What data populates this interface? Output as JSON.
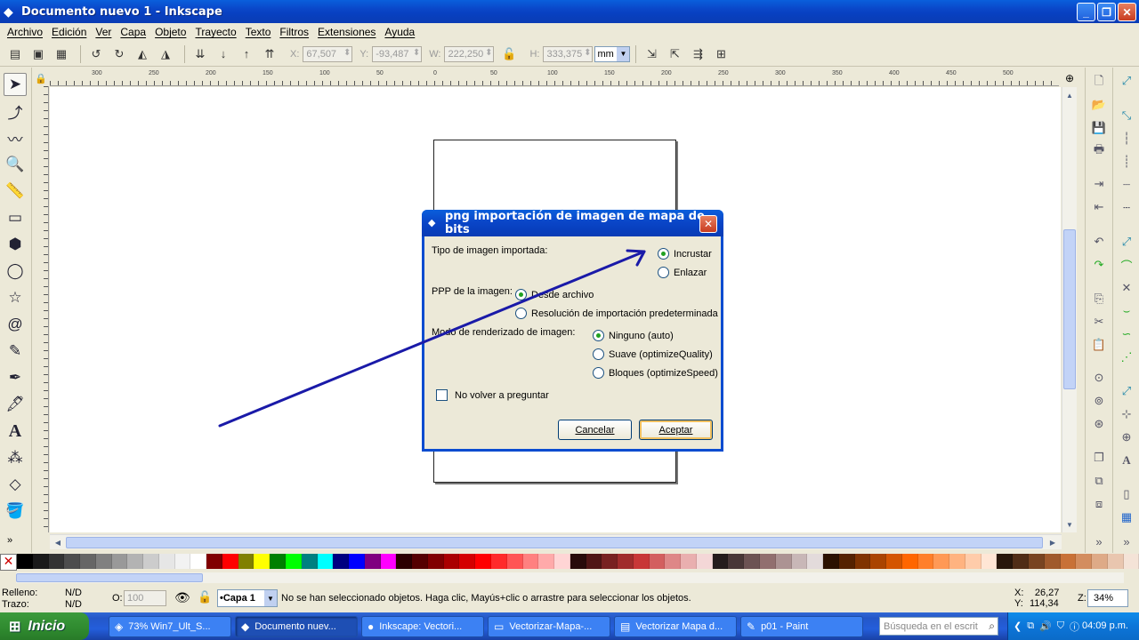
{
  "window": {
    "title": "Documento nuevo 1 - Inkscape"
  },
  "menu": [
    "Archivo",
    "Edición",
    "Ver",
    "Capa",
    "Objeto",
    "Trayecto",
    "Texto",
    "Filtros",
    "Extensiones",
    "Ayuda"
  ],
  "toolbar": {
    "x_label": "X:",
    "x_value": "67,507",
    "y_label": "Y:",
    "y_value": "-93,487",
    "w_label": "W:",
    "w_value": "222,250",
    "h_label": "H:",
    "h_value": "333,375",
    "unit": "mm"
  },
  "ruler_ticks": [
    "300",
    "250",
    "200",
    "150",
    "100",
    "50",
    "0",
    "50",
    "100",
    "150",
    "200",
    "250",
    "300",
    "350",
    "400",
    "450",
    "500"
  ],
  "dialog": {
    "title": "png importación de imagen de mapa de bits",
    "type_label": "Tipo de imagen importada:",
    "type_options": [
      "Incrustar",
      "Enlazar"
    ],
    "dpi_label": "PPP de la imagen:",
    "dpi_options": [
      "Desde archivo",
      "Resolución de importación predeterminada"
    ],
    "render_label": "Modo de renderizado de imagen:",
    "render_options": [
      "Ninguno (auto)",
      "Suave (optimizeQuality)",
      "Bloques (optimizeSpeed)"
    ],
    "dont_ask": "No volver a preguntar",
    "cancel": "Cancelar",
    "accept": "Aceptar"
  },
  "palette_colors": [
    "#000000",
    "#1a1a1a",
    "#333333",
    "#4d4d4d",
    "#666666",
    "#808080",
    "#999999",
    "#b3b3b3",
    "#cccccc",
    "#e6e6e6",
    "#f2f2f2",
    "#ffffff",
    "#800000",
    "#ff0000",
    "#808000",
    "#ffff00",
    "#008000",
    "#00ff00",
    "#008080",
    "#00ffff",
    "#000080",
    "#0000ff",
    "#800080",
    "#ff00ff",
    "#2b0000",
    "#550000",
    "#800000",
    "#aa0000",
    "#d40000",
    "#ff0000",
    "#ff2a2a",
    "#ff5555",
    "#ff8080",
    "#ffaaaa",
    "#ffd5d5",
    "#280b0b",
    "#501616",
    "#782121",
    "#a02c2c",
    "#c83737",
    "#d35f5f",
    "#de8787",
    "#e9afaf",
    "#f4d7d7",
    "#241c1c",
    "#483737",
    "#6c5353",
    "#916f6f",
    "#ac9393",
    "#c8b7b7",
    "#e3dbdb",
    "#2b1100",
    "#552200",
    "#803300",
    "#aa4400",
    "#d45500",
    "#ff6600",
    "#ff7f2a",
    "#ff9955",
    "#ffb380",
    "#ffccaa",
    "#ffe6d5",
    "#28170b",
    "#502d16",
    "#784421",
    "#a05a2c",
    "#c87137",
    "#d38d5f",
    "#deaa87",
    "#e9c6af",
    "#f4e3d7"
  ],
  "status": {
    "fill_label": "Relleno:",
    "fill_value": "N/D",
    "stroke_label": "Trazo:",
    "stroke_value": "N/D",
    "opacity_label": "O:",
    "opacity_value": "100",
    "layer": "•Capa 1",
    "message": "No se han seleccionado objetos. Haga clic, Mayús+clic o arrastre para seleccionar los objetos.",
    "x_label": "X:",
    "x_value": "26,27",
    "y_label": "Y:",
    "y_value": "114,34",
    "zoom_label": "Z:",
    "zoom_value": "34%"
  },
  "taskbar": {
    "start": "Inicio",
    "tasks": [
      "73% Win7_Ult_S...",
      "Documento nuev...",
      "Inkscape: Vectori...",
      "Vectorizar-Mapa-...",
      "Vectorizar Mapa d...",
      "p01 - Paint"
    ],
    "search_placeholder": "Búsqueda en el escrit",
    "clock": "04:09 p.m."
  }
}
